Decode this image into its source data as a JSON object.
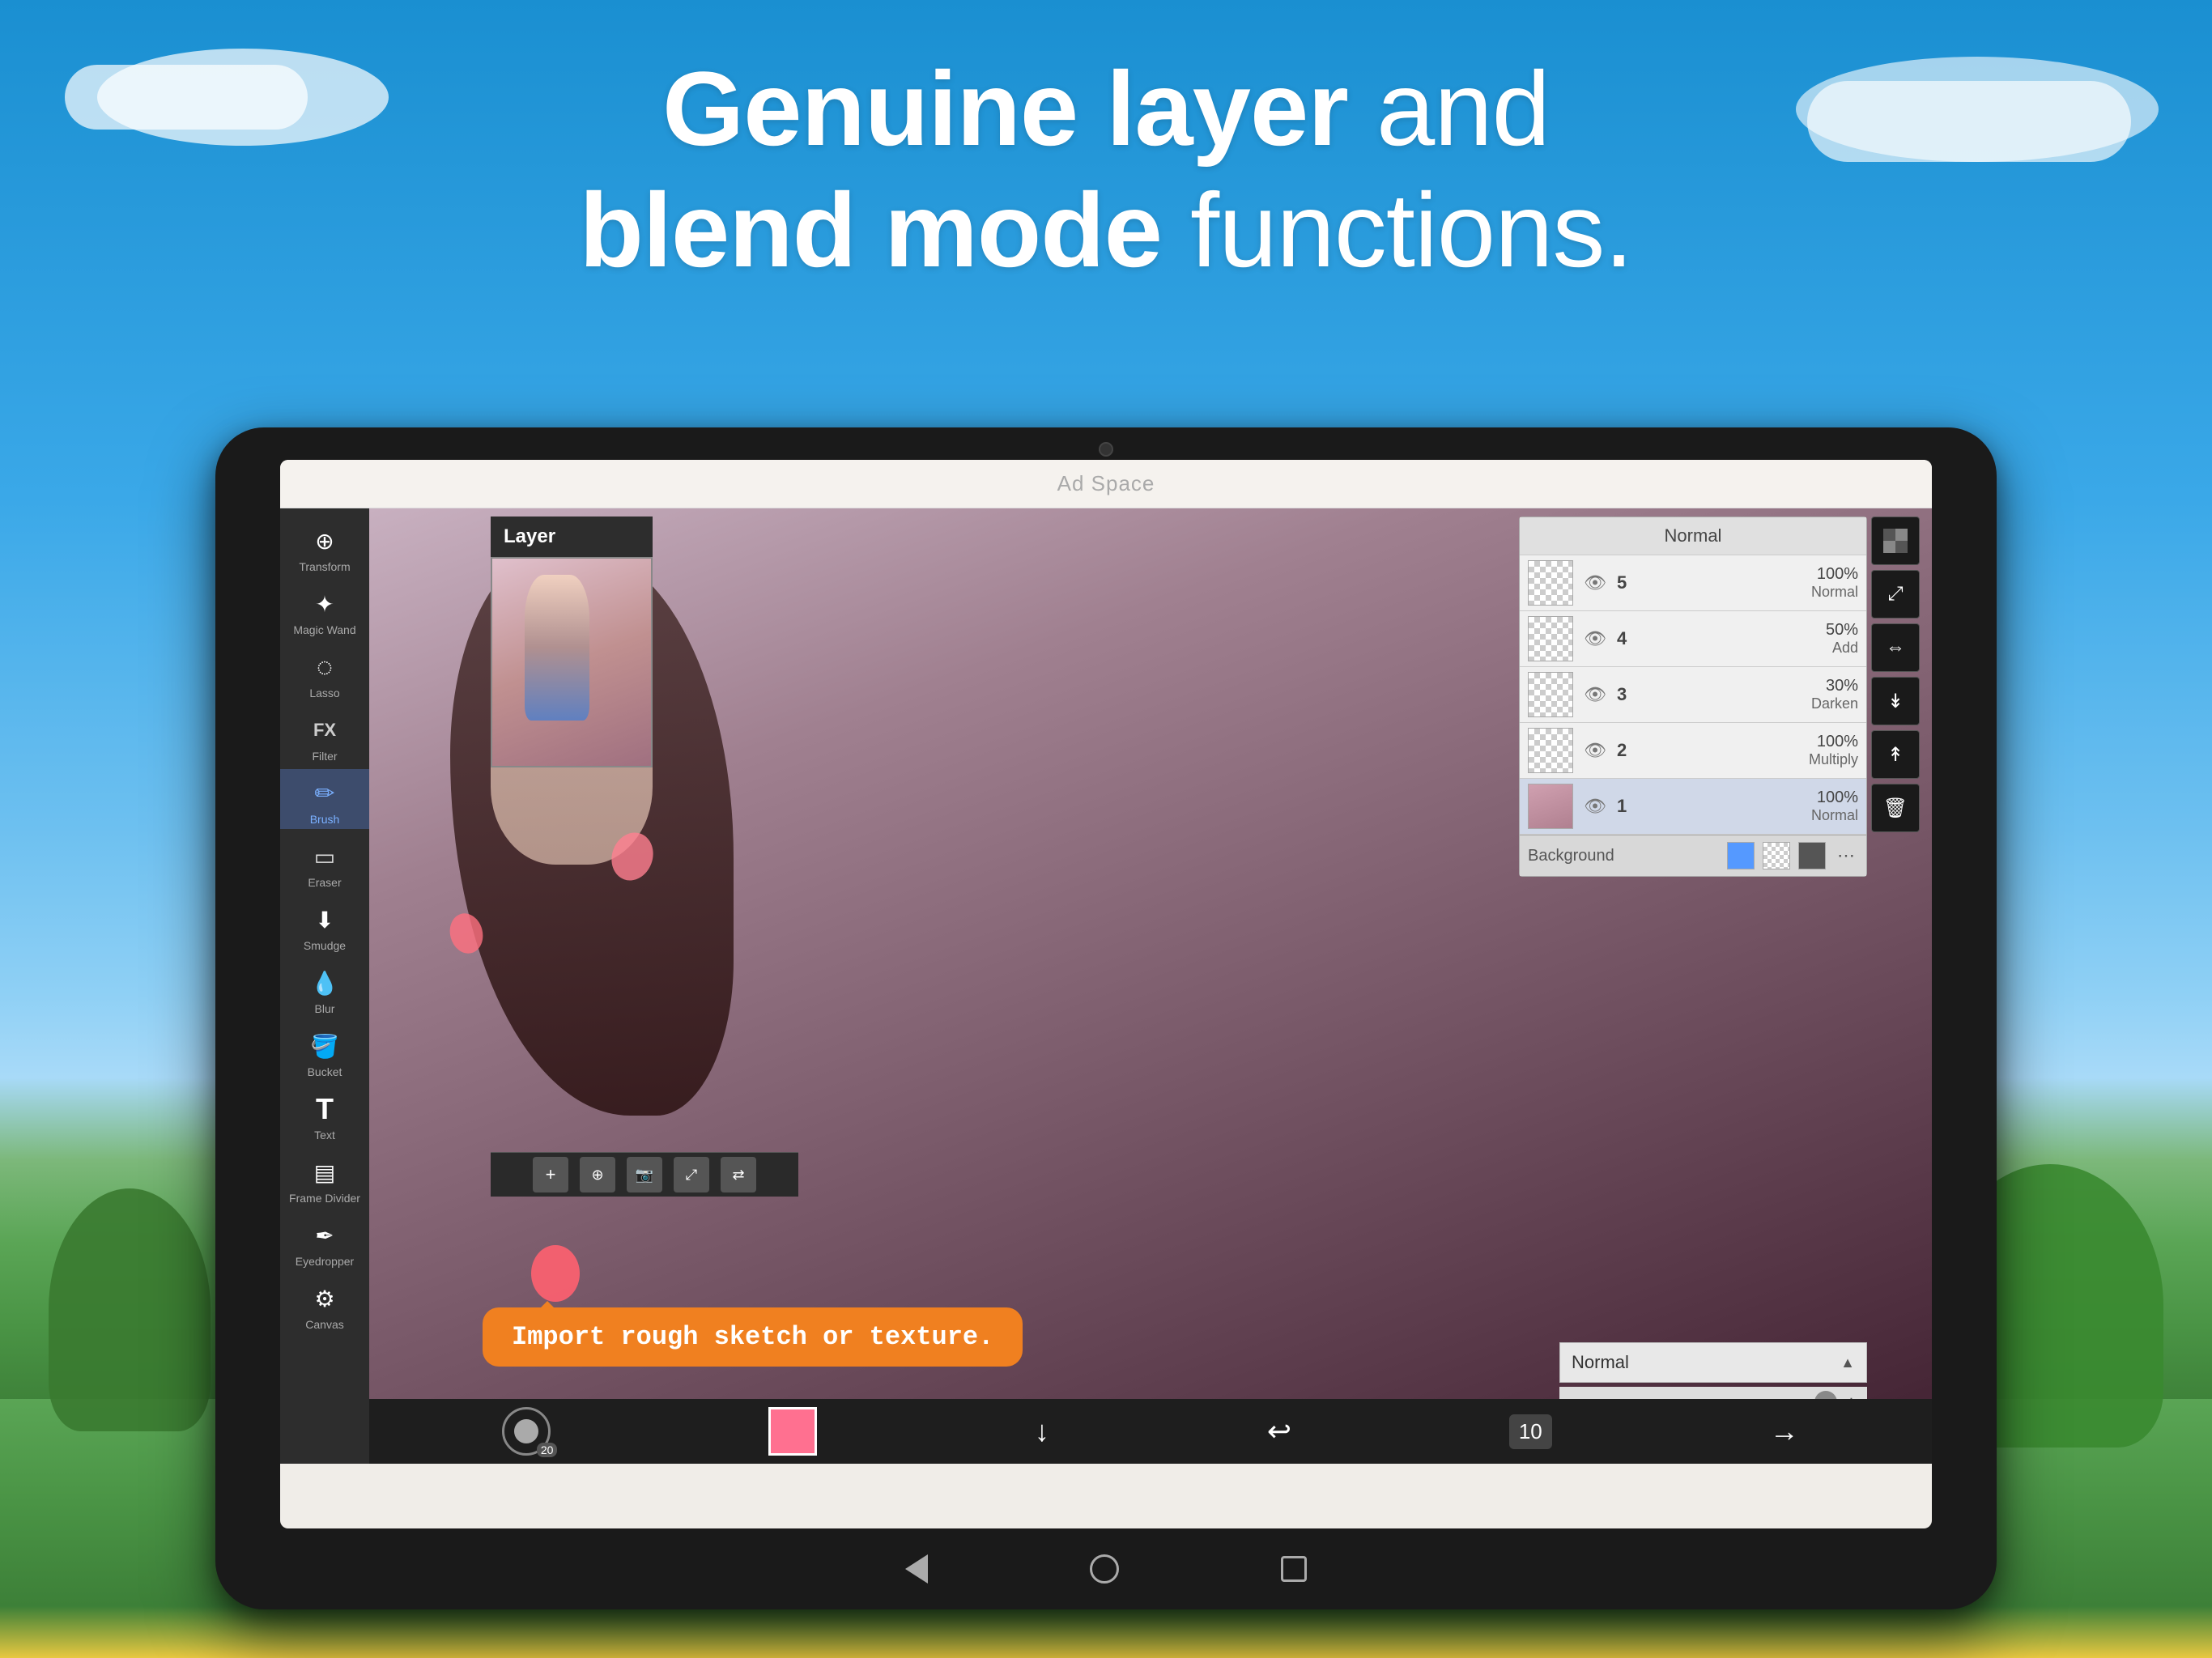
{
  "background": {
    "gradient_top": "#1a8fd1",
    "gradient_bottom": "#4a9c3a"
  },
  "headline": {
    "line1_bold": "Genuine layer",
    "line1_light": " and",
    "line2_bold": "blend mode",
    "line2_light": " functions."
  },
  "ad_bar": {
    "label": "Ad Space"
  },
  "toolbar": {
    "tools": [
      {
        "label": "Transform",
        "icon": "⊕"
      },
      {
        "label": "Magic Wand",
        "icon": "✦"
      },
      {
        "label": "Lasso",
        "icon": "◌"
      },
      {
        "label": "Filter",
        "icon": "FX"
      },
      {
        "label": "Brush",
        "icon": "✏️",
        "active": true
      },
      {
        "label": "Eraser",
        "icon": "◻"
      },
      {
        "label": "Smudge",
        "icon": "⬇"
      },
      {
        "label": "Blur",
        "icon": "💧"
      },
      {
        "label": "Bucket",
        "icon": "🪣"
      },
      {
        "label": "Text",
        "icon": "T"
      },
      {
        "label": "Frame Divider",
        "icon": "▤"
      },
      {
        "label": "Eyedropper",
        "icon": "✒"
      },
      {
        "label": "Canvas",
        "icon": "⚙"
      }
    ]
  },
  "layer_panel": {
    "title": "Layer"
  },
  "layer_list": {
    "blend_mode_header": "Normal",
    "layers": [
      {
        "num": "5",
        "opacity": "100%",
        "mode": "Normal",
        "visible": true
      },
      {
        "num": "4",
        "opacity": "50%",
        "mode": "Add",
        "visible": true
      },
      {
        "num": "3",
        "opacity": "30%",
        "mode": "Darken",
        "visible": true
      },
      {
        "num": "2",
        "opacity": "100%",
        "mode": "Multiply",
        "visible": true
      },
      {
        "num": "1",
        "opacity": "100%",
        "mode": "Normal",
        "visible": true
      }
    ],
    "background_label": "Background",
    "more_btn": "⋯"
  },
  "right_tools": [
    {
      "icon": "⊞",
      "label": "checker"
    },
    {
      "icon": "⤢",
      "label": "transform"
    },
    {
      "icon": "⇔",
      "label": "flip"
    },
    {
      "icon": "⬇",
      "label": "move-down"
    },
    {
      "icon": "🗑",
      "label": "delete"
    }
  ],
  "blend_mode_selector": {
    "label": "Normal",
    "arrow": "▲"
  },
  "tooltip": {
    "text": "Import rough sketch or texture."
  },
  "bottom_toolbar": {
    "brush_size": "20",
    "color": "#ff7090",
    "icons": [
      "↓",
      "↩",
      "10"
    ]
  },
  "nav_bar": {
    "back": "◁",
    "home": "○",
    "recent": "□"
  }
}
